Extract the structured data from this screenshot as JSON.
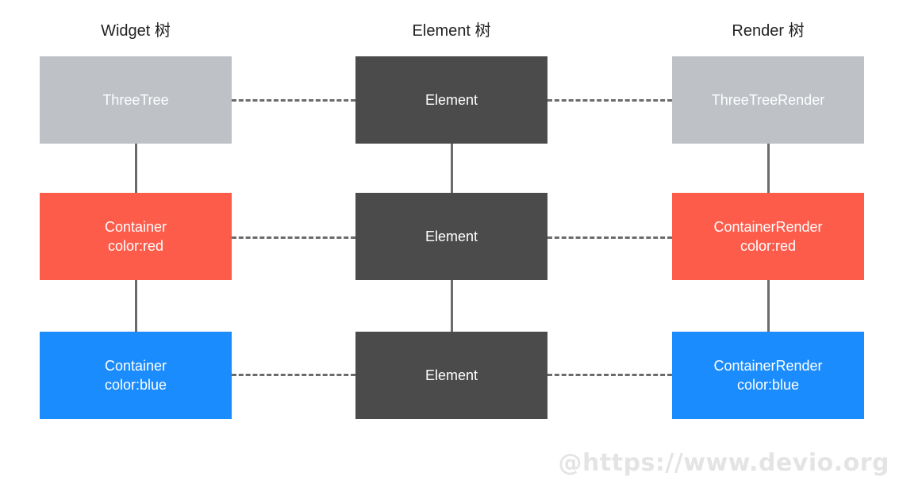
{
  "columns": [
    {
      "title": "Widget 树"
    },
    {
      "title": "Element 树"
    },
    {
      "title": "Render 树"
    }
  ],
  "rows": [
    {
      "widget": {
        "label": "ThreeTree",
        "color": "#bec2c7"
      },
      "element": {
        "label": "Element",
        "color": "#4b4b4b"
      },
      "render": {
        "label": "ThreeTreeRender",
        "color": "#bec2c7"
      }
    },
    {
      "widget": {
        "label": "Container\ncolor:red",
        "color": "#fe5c4b"
      },
      "element": {
        "label": "Element",
        "color": "#4b4b4b"
      },
      "render": {
        "label": "ContainerRender\ncolor:red",
        "color": "#fe5c4b"
      }
    },
    {
      "widget": {
        "label": "Container\ncolor:blue",
        "color": "#1a8cfe"
      },
      "element": {
        "label": "Element",
        "color": "#4b4b4b"
      },
      "render": {
        "label": "ContainerRender\ncolor:blue",
        "color": "#1a8cfe"
      }
    }
  ],
  "connector_color": "#6b6b6b",
  "watermark": "@https://www.devio.org"
}
